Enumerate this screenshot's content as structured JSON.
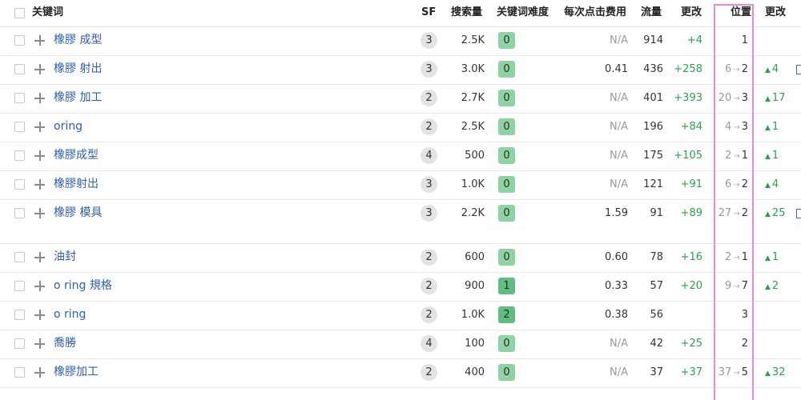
{
  "header": {
    "keyword": "关键词",
    "sf": "SF",
    "volume": "搜索量",
    "kd": "关键词难度",
    "cpc": "每次点击费用",
    "traffic": "流量",
    "change": "更改",
    "position": "位置",
    "pos_change": "更改"
  },
  "rows": [
    {
      "keyword": "橡膠 成型",
      "sf": "3",
      "volume": "2.5K",
      "kd": "0",
      "cpc": "N/A",
      "traffic": "914",
      "change": "+4",
      "pos_from": "",
      "pos_to": "1",
      "pos_change": ""
    },
    {
      "keyword": "橡膠 射出",
      "sf": "3",
      "volume": "3.0K",
      "kd": "0",
      "cpc": "0.41",
      "traffic": "436",
      "change": "+258",
      "pos_from": "6",
      "pos_to": "2",
      "pos_change": "4"
    },
    {
      "keyword": "橡膠 加工",
      "sf": "2",
      "volume": "2.7K",
      "kd": "0",
      "cpc": "N/A",
      "traffic": "401",
      "change": "+393",
      "pos_from": "20",
      "pos_to": "3",
      "pos_change": "17"
    },
    {
      "keyword": "oring",
      "sf": "2",
      "volume": "2.5K",
      "kd": "0",
      "cpc": "N/A",
      "traffic": "196",
      "change": "+84",
      "pos_from": "4",
      "pos_to": "3",
      "pos_change": "1"
    },
    {
      "keyword": "橡膠成型",
      "sf": "4",
      "volume": "500",
      "kd": "0",
      "cpc": "N/A",
      "traffic": "175",
      "change": "+105",
      "pos_from": "2",
      "pos_to": "1",
      "pos_change": "1"
    },
    {
      "keyword": "橡膠射出",
      "sf": "3",
      "volume": "1.0K",
      "kd": "0",
      "cpc": "N/A",
      "traffic": "121",
      "change": "+91",
      "pos_from": "6",
      "pos_to": "2",
      "pos_change": "4"
    },
    {
      "keyword": "橡膠 模具",
      "sf": "3",
      "volume": "2.2K",
      "kd": "0",
      "cpc": "1.59",
      "traffic": "91",
      "change": "+89",
      "pos_from": "27",
      "pos_to": "2",
      "pos_change": "25"
    },
    {
      "keyword": "油封",
      "sf": "2",
      "volume": "600",
      "kd": "0",
      "cpc": "0.60",
      "traffic": "78",
      "change": "+16",
      "pos_from": "2",
      "pos_to": "1",
      "pos_change": "1"
    },
    {
      "keyword": "o ring 規格",
      "sf": "2",
      "volume": "900",
      "kd": "1",
      "cpc": "0.33",
      "traffic": "57",
      "change": "+20",
      "pos_from": "9",
      "pos_to": "7",
      "pos_change": "2"
    },
    {
      "keyword": "o ring",
      "sf": "2",
      "volume": "1.0K",
      "kd": "2",
      "cpc": "0.38",
      "traffic": "56",
      "change": "",
      "pos_from": "",
      "pos_to": "3",
      "pos_change": ""
    },
    {
      "keyword": "喬勝",
      "sf": "4",
      "volume": "100",
      "kd": "0",
      "cpc": "N/A",
      "traffic": "42",
      "change": "+25",
      "pos_from": "",
      "pos_to": "2",
      "pos_change": ""
    },
    {
      "keyword": "橡膠加工",
      "sf": "2",
      "volume": "400",
      "kd": "0",
      "cpc": "N/A",
      "traffic": "37",
      "change": "+37",
      "pos_from": "37",
      "pos_to": "5",
      "pos_change": "32"
    }
  ],
  "colors": {
    "link": "#2f5da8",
    "green": "#2e9e4f",
    "kd_badge": "#8fd3a3",
    "highlight": "#e78cc8"
  },
  "icons": [
    "checkbox-icon",
    "plus-icon",
    "arrow-right-icon",
    "triangle-up-icon"
  ]
}
